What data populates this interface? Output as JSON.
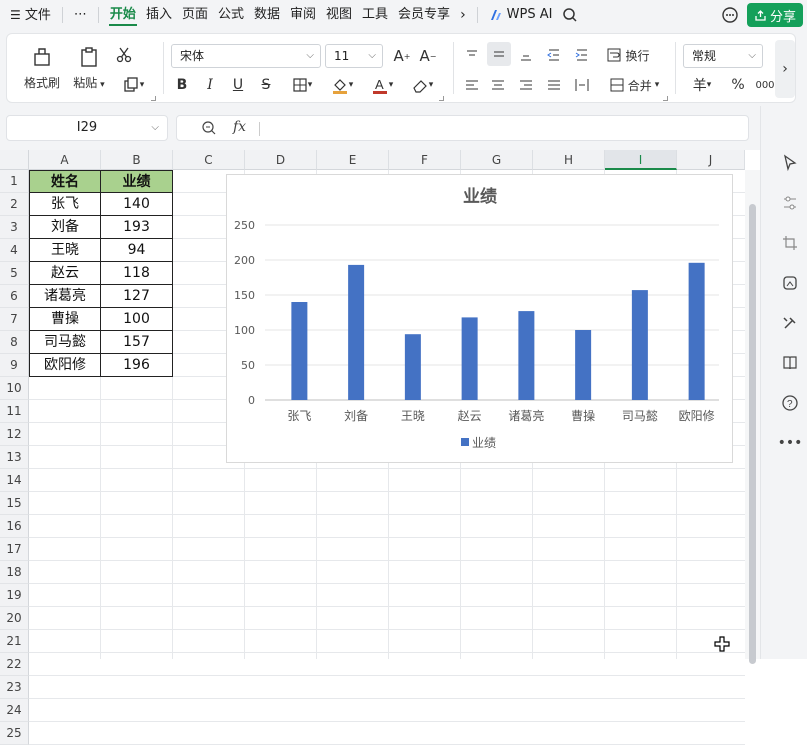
{
  "menubar": {
    "file_label": "文件",
    "more_label": "⋯",
    "tabs": [
      "开始",
      "插入",
      "页面",
      "公式",
      "数据",
      "审阅",
      "视图",
      "工具",
      "会员专享"
    ],
    "wps_ai_label": "WPS AI",
    "share_label": "分享"
  },
  "ribbon": {
    "format_painter_label": "格式刷",
    "paste_label": "粘贴",
    "font_name": "宋体",
    "font_size": "11",
    "wrap_label": "换行",
    "merge_label": "合并",
    "number_format": "常规",
    "currency_symbol": "羊",
    "percent_symbol": "%",
    "thousands_symbol": "000"
  },
  "formula_bar": {
    "cell_ref": "I29",
    "fx_label": "fx",
    "formula": ""
  },
  "columns": [
    "A",
    "B",
    "C",
    "D",
    "E",
    "F",
    "G",
    "H",
    "I",
    "J"
  ],
  "selected_column": "I",
  "rows": [
    "1",
    "2",
    "3",
    "4",
    "5",
    "6",
    "7",
    "8",
    "9",
    "10",
    "11",
    "12",
    "13",
    "14",
    "15",
    "16",
    "17",
    "18",
    "19",
    "20",
    "21",
    "22",
    "23",
    "24",
    "25"
  ],
  "table": {
    "headers": [
      "姓名",
      "业绩"
    ],
    "rows": [
      [
        "张飞",
        "140"
      ],
      [
        "刘备",
        "193"
      ],
      [
        "王晓",
        "94"
      ],
      [
        "赵云",
        "118"
      ],
      [
        "诸葛亮",
        "127"
      ],
      [
        "曹操",
        "100"
      ],
      [
        "司马懿",
        "157"
      ],
      [
        "欧阳修",
        "196"
      ]
    ],
    "header_color": "#a9d18e"
  },
  "chart_data": {
    "type": "bar",
    "title": "业绩",
    "categories": [
      "张飞",
      "刘备",
      "王晓",
      "赵云",
      "诸葛亮",
      "曹操",
      "司马懿",
      "欧阳修"
    ],
    "series": [
      {
        "name": "业绩",
        "values": [
          140,
          193,
          94,
          118,
          127,
          100,
          157,
          196
        ],
        "color": "#4472c4"
      }
    ],
    "ylim": [
      0,
      250
    ],
    "yticks": [
      "0",
      "50",
      "100",
      "150",
      "200",
      "250"
    ],
    "grid": true,
    "legend": "bottom",
    "xlabel": "",
    "ylabel": ""
  },
  "colors": {
    "accent": "#1a8a4a",
    "share_button": "#14a05a"
  }
}
